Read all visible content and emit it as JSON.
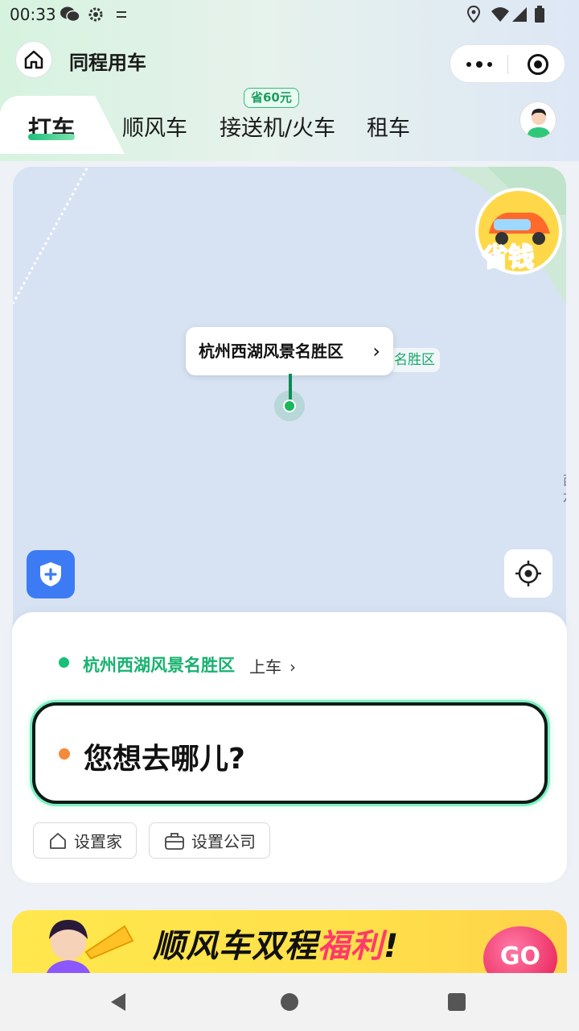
{
  "status_bar": {
    "time": "00:33"
  },
  "header": {
    "title": "同程用车"
  },
  "tabs": [
    {
      "label": "打车",
      "active": true
    },
    {
      "label": "顺风车",
      "active": false
    },
    {
      "label": "接送机/火车",
      "active": false,
      "badge": "省60元"
    },
    {
      "label": "租车",
      "active": false
    }
  ],
  "map": {
    "pickup_bubble": "杭州西湖风景名胜区",
    "label_behind": "名胜区",
    "right_edge_text": "西六",
    "promo_badge_text": "省钱"
  },
  "card": {
    "from_place": "杭州西湖风景名胜区",
    "from_suffix": "上车",
    "destination_placeholder": "您想去哪儿?",
    "chips": [
      {
        "label": "设置家",
        "icon": "home-icon"
      },
      {
        "label": "设置公司",
        "icon": "briefcase-icon"
      }
    ]
  },
  "banner": {
    "title_main": "顺风车双程",
    "title_highlight": "福利",
    "title_end": "!",
    "go_label": "GO"
  },
  "colors": {
    "brand_green": "#17b26f",
    "accent_orange": "#f58a3c",
    "map_bg": "#d7e3f3",
    "shield_blue": "#3d7bf5"
  }
}
